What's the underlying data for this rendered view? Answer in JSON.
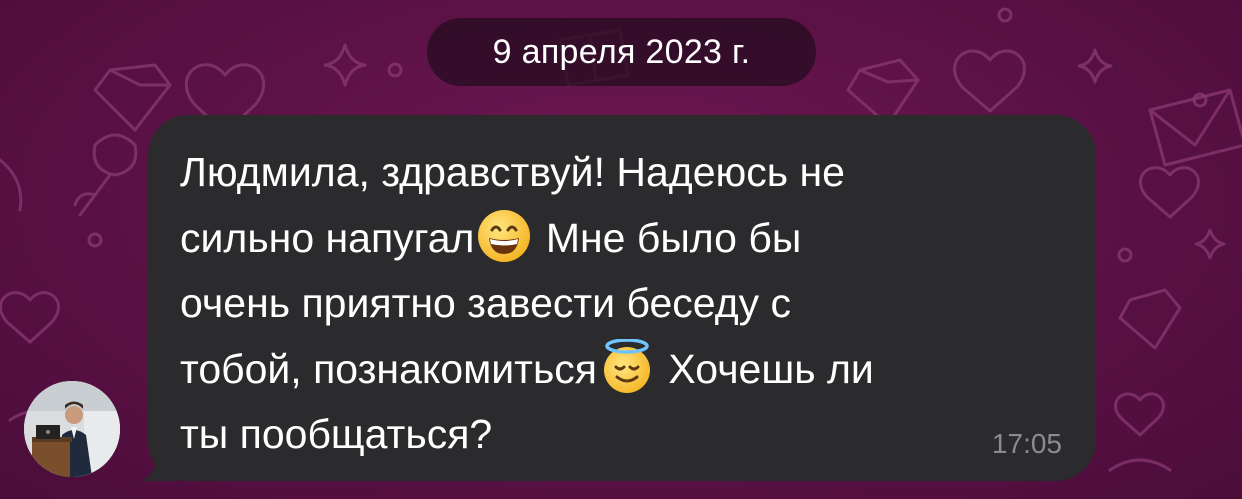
{
  "chat": {
    "date_separator": "9 апреля 2023 г.",
    "message": {
      "segments": [
        "Людмила, здравствуй! Надеюсь не\nсильно напугал",
        " Мне было бы\nочень приятно завести беседу с\nтобой, познакомиться",
        " Хочешь ли\nты пообщаться?"
      ],
      "emojis": [
        "grinning-face-emoji",
        "smiling-face-with-halo-emoji"
      ],
      "time": "17:05"
    },
    "sender": {
      "avatar_icon": "person-at-podium-photo"
    }
  },
  "theme": {
    "background": "#5a1145",
    "pattern_stroke": "#8a3a72",
    "bubble": "#2b2a2c",
    "text": "#ffffff",
    "time": "#8c8a8f"
  }
}
